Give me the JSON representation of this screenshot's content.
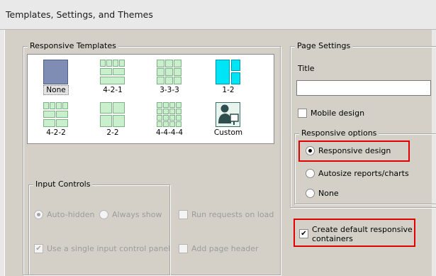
{
  "window": {
    "title": "Templates, Settings, and Themes"
  },
  "responsive_templates": {
    "legend": "Responsive Templates",
    "selected": "None",
    "items": [
      {
        "label": "None",
        "icon": "blank-layout-icon"
      },
      {
        "label": "4-2-1",
        "icon": "grid-4-2-1-icon"
      },
      {
        "label": "3-3-3",
        "icon": "grid-3-3-3-icon"
      },
      {
        "label": "1-2",
        "icon": "grid-1-2-icon"
      },
      {
        "label": "4-2-2",
        "icon": "grid-4-2-2-icon"
      },
      {
        "label": "2-2",
        "icon": "grid-2-2-icon"
      },
      {
        "label": "4-4-4-4",
        "icon": "grid-4-4-4-4-icon"
      },
      {
        "label": "Custom",
        "icon": "custom-user-icon"
      }
    ]
  },
  "input_controls": {
    "legend": "Input Controls",
    "auto_hidden": {
      "label": "Auto-hidden",
      "checked": true,
      "enabled": false
    },
    "always_show": {
      "label": "Always show",
      "checked": false,
      "enabled": false
    },
    "run_requests": {
      "label": "Run requests on load",
      "checked": false,
      "enabled": false
    },
    "single_panel": {
      "label": "Use a single input control panel",
      "checked": true,
      "enabled": false
    },
    "page_header": {
      "label": "Add page header",
      "checked": false,
      "enabled": false
    }
  },
  "page_settings": {
    "legend": "Page Settings",
    "title_label": "Title",
    "title_value": "",
    "mobile_design": {
      "label": "Mobile design",
      "checked": false
    },
    "responsive_options": {
      "legend": "Responsive options",
      "selected": "Responsive design",
      "options": [
        "Responsive design",
        "Autosize reports/charts",
        "None"
      ]
    },
    "default_containers": {
      "label_line1": "Create default responsive",
      "label_line2": "containers",
      "checked": true
    }
  },
  "colors": {
    "highlight": "#e00000",
    "thumb_green": "#c9efcd",
    "thumb_cyan": "#00e5f5",
    "thumb_blue": "#7f8db5"
  }
}
